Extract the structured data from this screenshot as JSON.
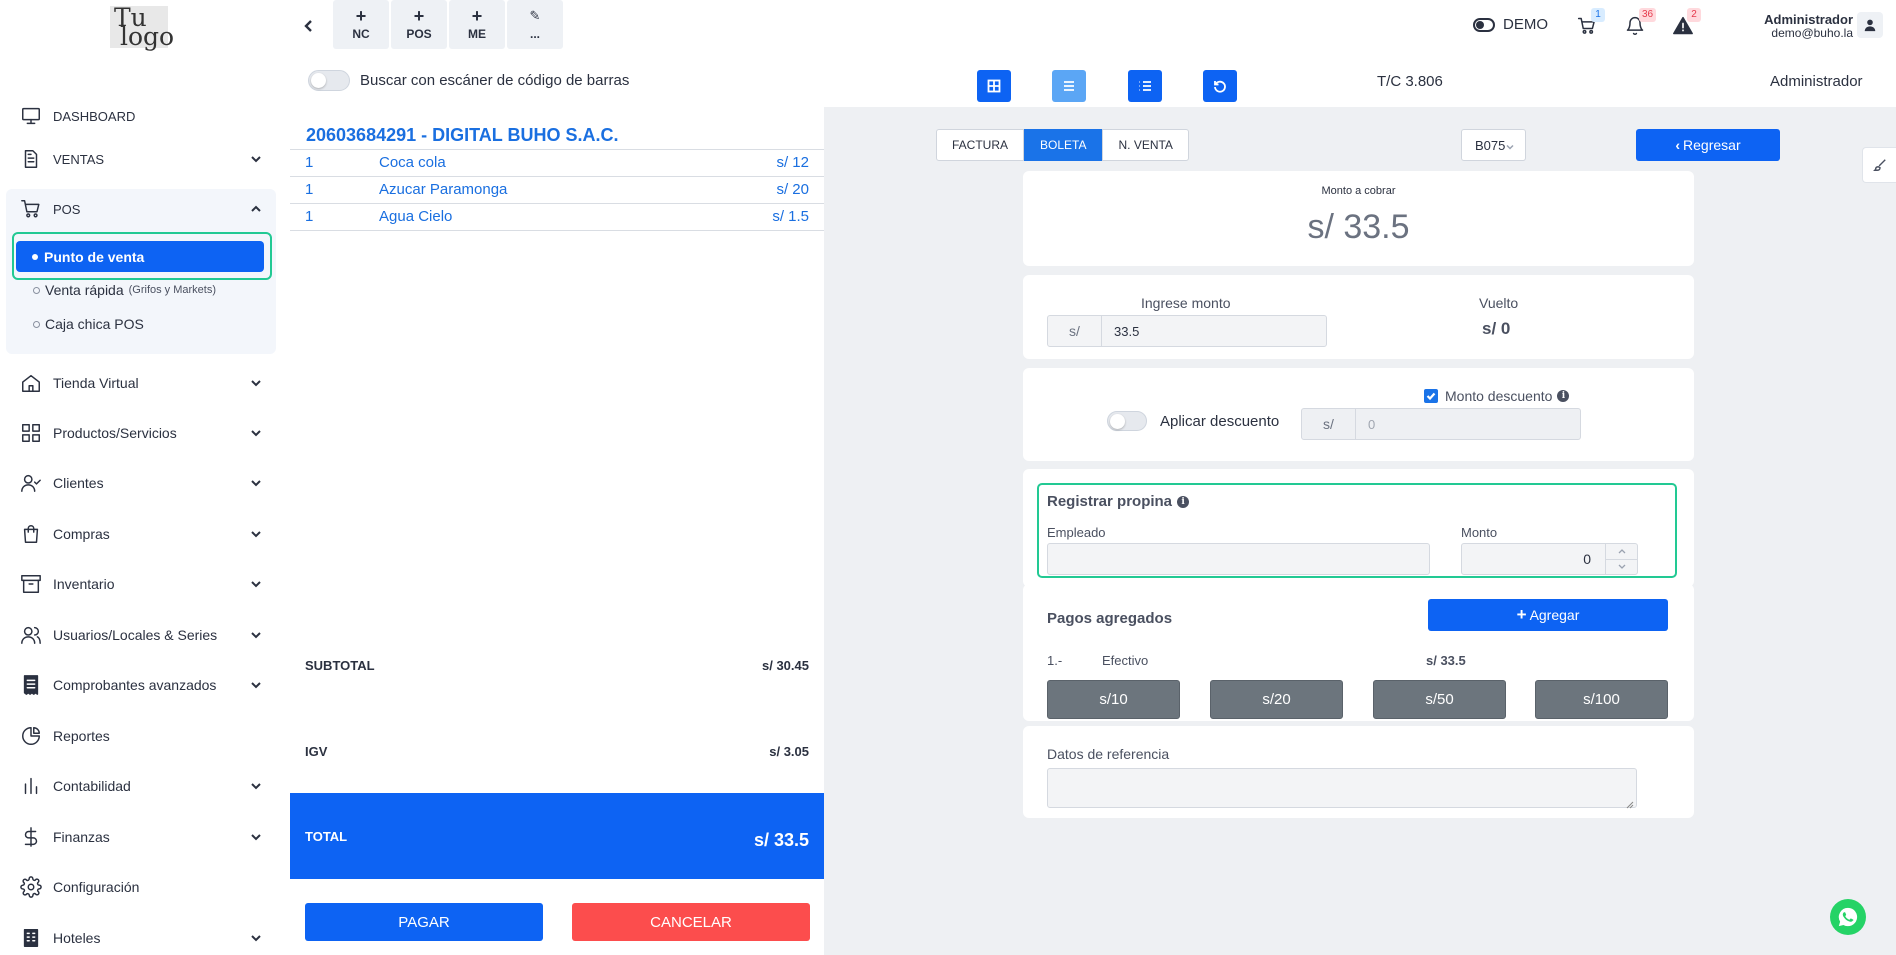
{
  "logo": {
    "line1": "Tu",
    "line2": "logo"
  },
  "sidebar": {
    "items": [
      {
        "label": "DASHBOARD",
        "icon": "monitor-icon"
      },
      {
        "label": "VENTAS",
        "icon": "document-icon"
      },
      {
        "label": "POS",
        "icon": "cart-icon"
      },
      {
        "label": "Tienda Virtual",
        "icon": "home-icon"
      },
      {
        "label": "Productos/Servicios",
        "icon": "grid-icon"
      },
      {
        "label": "Clientes",
        "icon": "user-check-icon"
      },
      {
        "label": "Compras",
        "icon": "shopping-bag-icon"
      },
      {
        "label": "Inventario",
        "icon": "archive-icon"
      },
      {
        "label": "Usuarios/Locales & Series",
        "icon": "users-icon"
      },
      {
        "label": "Comprobantes avanzados",
        "icon": "receipt-icon"
      },
      {
        "label": "Reportes",
        "icon": "pie-chart-icon"
      },
      {
        "label": "Contabilidad",
        "icon": "bar-chart-icon"
      },
      {
        "label": "Finanzas",
        "icon": "dollar-icon"
      },
      {
        "label": "Configuración",
        "icon": "gear-icon"
      },
      {
        "label": "Hoteles",
        "icon": "building-icon"
      }
    ],
    "pos_sub": {
      "active": "Punto de venta",
      "item2": "Venta rápida",
      "item2_note": "(Grifos y Markets)",
      "item3": "Caja chica POS"
    }
  },
  "topbar": {
    "quick": [
      {
        "plus": "+",
        "label": "NC"
      },
      {
        "plus": "+",
        "label": "POS"
      },
      {
        "plus": "+",
        "label": "ME"
      },
      {
        "plus": "✎",
        "label": "..."
      }
    ],
    "demo_label": "DEMO",
    "cart_badge": "1",
    "bell_badge": "36",
    "alert_badge": "2",
    "user_name": "Administrador",
    "user_email": "demo@buho.la"
  },
  "toolbar": {
    "barcode_label": "Buscar con escáner de código de barras",
    "exchange_rate": "T/C 3.806",
    "admin": "Administrador"
  },
  "cart": {
    "customer": "20603684291 - DIGITAL BUHO S.A.C.",
    "items": [
      {
        "qty": "1",
        "name": "Coca cola",
        "price": "s/ 12"
      },
      {
        "qty": "1",
        "name": "Azucar Paramonga",
        "price": "s/ 20"
      },
      {
        "qty": "1",
        "name": "Agua Cielo",
        "price": "s/ 1.5"
      }
    ],
    "subtotal_label": "SUBTOTAL",
    "subtotal_value": "s/ 30.45",
    "igv_label": "IGV",
    "igv_value": "s/ 3.05",
    "total_label": "TOTAL",
    "total_value": "s/ 33.5",
    "pay_label": "PAGAR",
    "cancel_label": "CANCELAR"
  },
  "payment": {
    "doc_tabs": [
      "FACTURA",
      "BOLETA",
      "N. VENTA"
    ],
    "active_doc_tab": "BOLETA",
    "serie": "B075",
    "back_label": "Regresar",
    "amount_label": "Monto a cobrar",
    "amount_value": "s/ 33.5",
    "ingrese_label": "Ingrese monto",
    "currency_prefix": "s/",
    "ingrese_value": "33.5",
    "vuelto_label": "Vuelto",
    "vuelto_value": "s/ 0",
    "apply_discount_label": "Aplicar descuento",
    "monto_descuento_label": "Monto descuento",
    "descuento_placeholder": "0",
    "propina_title": "Registrar propina",
    "empleado_label": "Empleado",
    "empleado_value": "",
    "monto_label": "Monto",
    "monto_value": "0",
    "pagos_title": "Pagos agregados",
    "agregar_label": "Agregar",
    "pago_index": "1.-",
    "pago_method": "Efectivo",
    "pago_amount": "s/ 33.5",
    "cash_buttons": [
      "s/10",
      "s/20",
      "s/50",
      "s/100"
    ],
    "referencia_label": "Datos de referencia",
    "referencia_value": ""
  },
  "colors": {
    "primary": "#0d63f3",
    "danger": "#fc4d4d",
    "highlight": "#22c993",
    "cash_button": "#6c757d"
  }
}
